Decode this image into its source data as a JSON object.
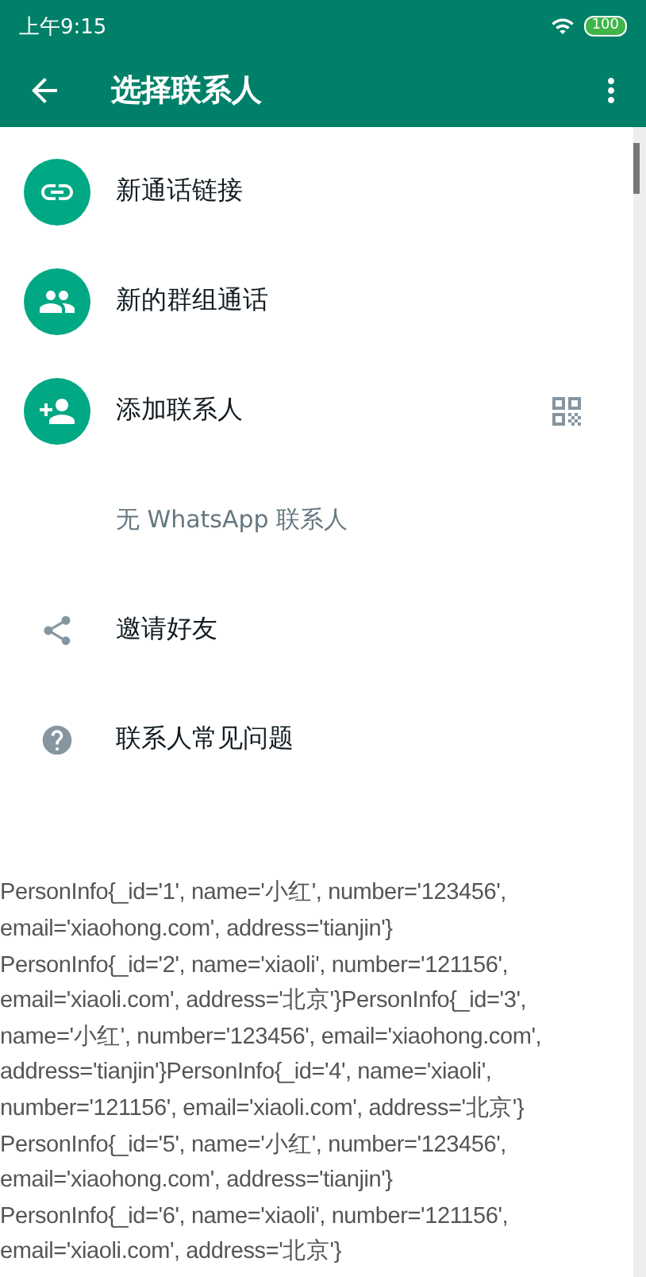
{
  "status_bar": {
    "time": "上午9:15",
    "battery": "100"
  },
  "toolbar": {
    "title": "选择联系人"
  },
  "items": [
    {
      "kind": "circle",
      "label": "新通话链接"
    },
    {
      "kind": "circle",
      "label": "新的群组通话"
    },
    {
      "kind": "circle",
      "label": "添加联系人"
    },
    {
      "kind": "note",
      "label": "无 WhatsApp 联系人"
    },
    {
      "kind": "plain",
      "label": "邀请好友"
    },
    {
      "kind": "plain",
      "label": "联系人常见问题"
    }
  ],
  "log_lines": [
    "PersonInfo{_id='1', name='小红', number='123456',",
    "email='xiaohong.com', address='tianjin'}",
    "PersonInfo{_id='2', name='xiaoli', number='121156',",
    "email='xiaoli.com', address='北京'}PersonInfo{_id='3',",
    "name='小红', number='123456', email='xiaohong.com',",
    "address='tianjin'}PersonInfo{_id='4', name='xiaoli',",
    "number='121156', email='xiaoli.com', address='北京'}",
    "PersonInfo{_id='5', name='小红', number='123456',",
    "email='xiaohong.com', address='tianjin'}",
    "PersonInfo{_id='6', name='xiaoli', number='121156',",
    "email='xiaoli.com', address='北京'}"
  ]
}
